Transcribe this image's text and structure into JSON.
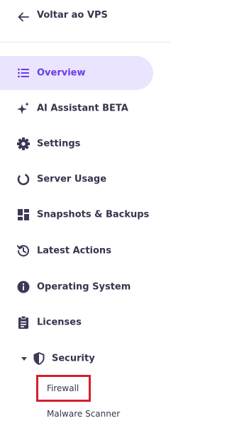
{
  "back": {
    "label": "Voltar ao VPS"
  },
  "nav": {
    "items": [
      {
        "id": "overview",
        "label": "Overview",
        "icon": "list-icon",
        "active": true
      },
      {
        "id": "ai-assistant",
        "label": "AI Assistant BETA",
        "icon": "sparkle-icon"
      },
      {
        "id": "settings",
        "label": "Settings",
        "icon": "gear-icon"
      },
      {
        "id": "server-usage",
        "label": "Server Usage",
        "icon": "usage-ring-icon"
      },
      {
        "id": "snapshots",
        "label": "Snapshots & Backups",
        "icon": "snapshots-icon"
      },
      {
        "id": "latest-actions",
        "label": "Latest Actions",
        "icon": "history-icon"
      },
      {
        "id": "operating-system",
        "label": "Operating System",
        "icon": "info-icon"
      },
      {
        "id": "licenses",
        "label": "Licenses",
        "icon": "clipboard-icon"
      }
    ],
    "security": {
      "label": "Security",
      "expanded": true,
      "icon": "shield-icon",
      "children": [
        {
          "label": "Firewall",
          "highlighted": true
        },
        {
          "label": "Malware Scanner"
        }
      ]
    }
  },
  "colors": {
    "accent": "#673de6",
    "active_bg": "#ebe4ff",
    "text": "#36344d",
    "icon": "#3b3955",
    "highlight_border": "#d61f2c"
  }
}
